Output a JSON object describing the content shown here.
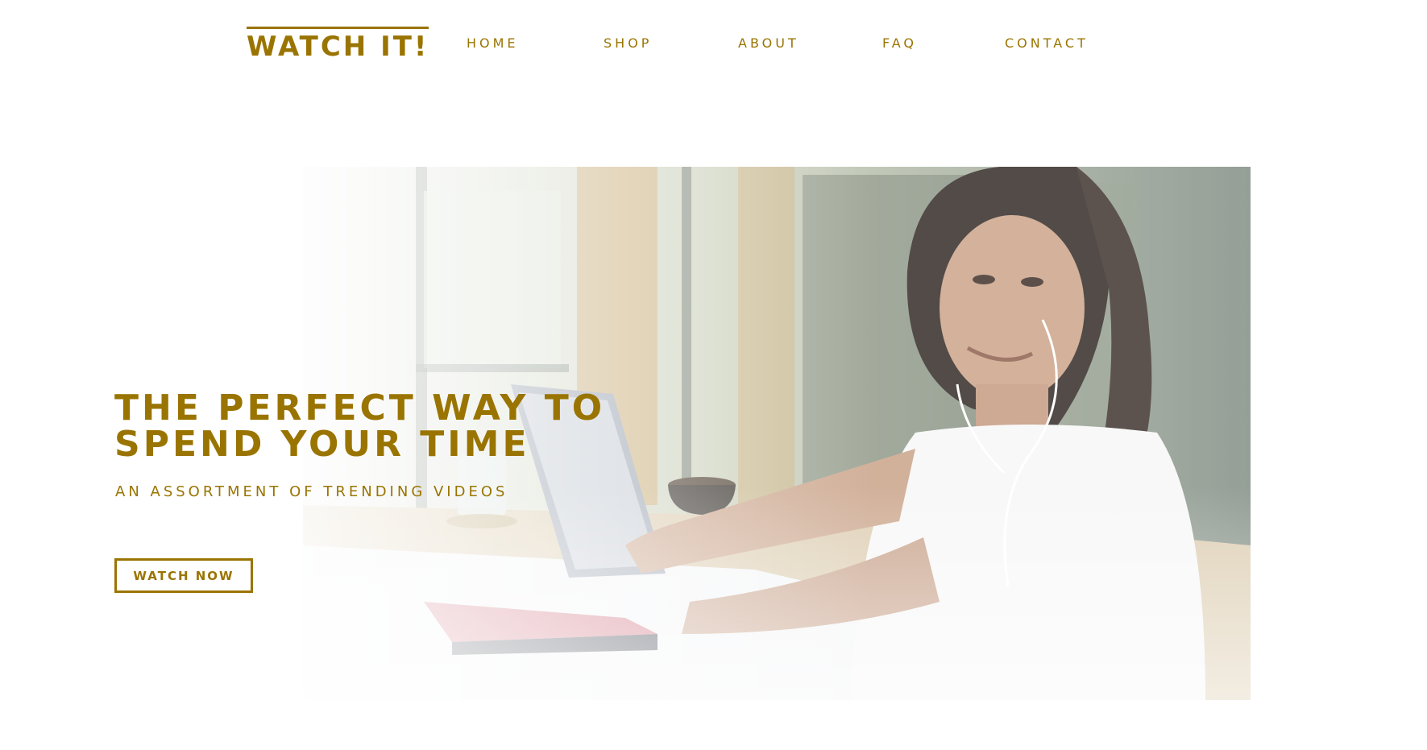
{
  "brand": {
    "logo": "WATCH IT!"
  },
  "nav": {
    "items": [
      {
        "label": "HOME"
      },
      {
        "label": "SHOP"
      },
      {
        "label": "ABOUT"
      },
      {
        "label": "FAQ"
      },
      {
        "label": "CONTACT"
      }
    ]
  },
  "hero": {
    "title": "THE PERFECT WAY TO SPEND YOUR TIME",
    "subtitle": "AN ASSORTMENT OF TRENDING VIDEOS",
    "cta_label": "WATCH NOW"
  },
  "colors": {
    "accent": "#9a7400",
    "background": "#ffffff"
  }
}
